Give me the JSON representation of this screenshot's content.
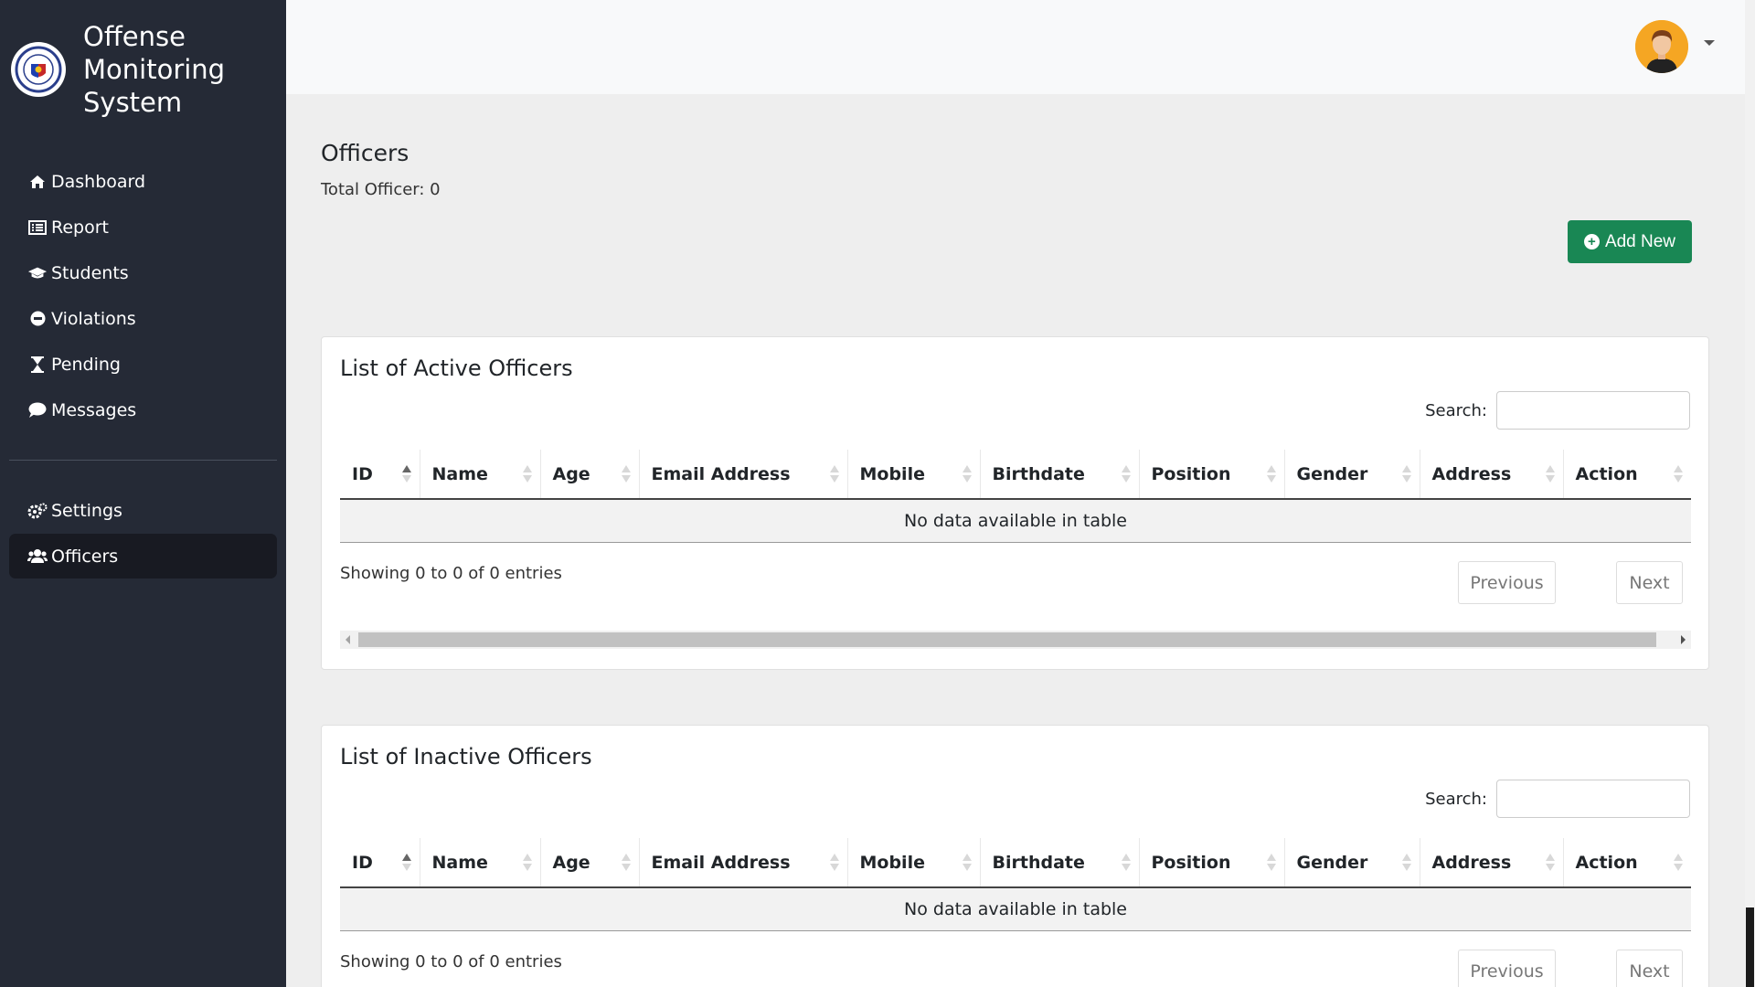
{
  "brand": {
    "title_line1": "Offense",
    "title_line2": "Monitoring",
    "title_line3": "System"
  },
  "sidebar": {
    "items": [
      {
        "label": "Dashboard",
        "icon": "home-icon"
      },
      {
        "label": "Report",
        "icon": "list-alt-icon"
      },
      {
        "label": "Students",
        "icon": "graduation-cap-icon"
      },
      {
        "label": "Violations",
        "icon": "minus-circle-icon"
      },
      {
        "label": "Pending",
        "icon": "hourglass-icon"
      },
      {
        "label": "Messages",
        "icon": "comment-icon"
      }
    ],
    "bottom_items": [
      {
        "label": "Settings",
        "icon": "cogs-icon"
      },
      {
        "label": "Officers",
        "icon": "users-icon",
        "active": true
      }
    ]
  },
  "header": {
    "avatar": "user-avatar-icon"
  },
  "page": {
    "title": "Officers",
    "total": "Total Officer: 0",
    "add_button": "Add New"
  },
  "active_table": {
    "title": "List of Active Officers",
    "search_label": "Search:",
    "search_value": "",
    "columns": [
      "ID",
      "Name",
      "Age",
      "Email Address",
      "Mobile",
      "Birthdate",
      "Position",
      "Gender",
      "Address",
      "Action"
    ],
    "empty_message": "No data available in table",
    "info": "Showing 0 to 0 of 0 entries",
    "prev": "Previous",
    "next": "Next"
  },
  "inactive_table": {
    "title": "List of Inactive Officers",
    "search_label": "Search:",
    "search_value": "",
    "columns": [
      "ID",
      "Name",
      "Age",
      "Email Address",
      "Mobile",
      "Birthdate",
      "Position",
      "Gender",
      "Address",
      "Action"
    ],
    "empty_message": "No data available in table",
    "info": "Showing 0 to 0 of 0 entries",
    "prev": "Previous",
    "next": "Next"
  },
  "colors": {
    "sidebar": "#252a36",
    "accent_green": "#198754",
    "active_item": "#181a22"
  }
}
